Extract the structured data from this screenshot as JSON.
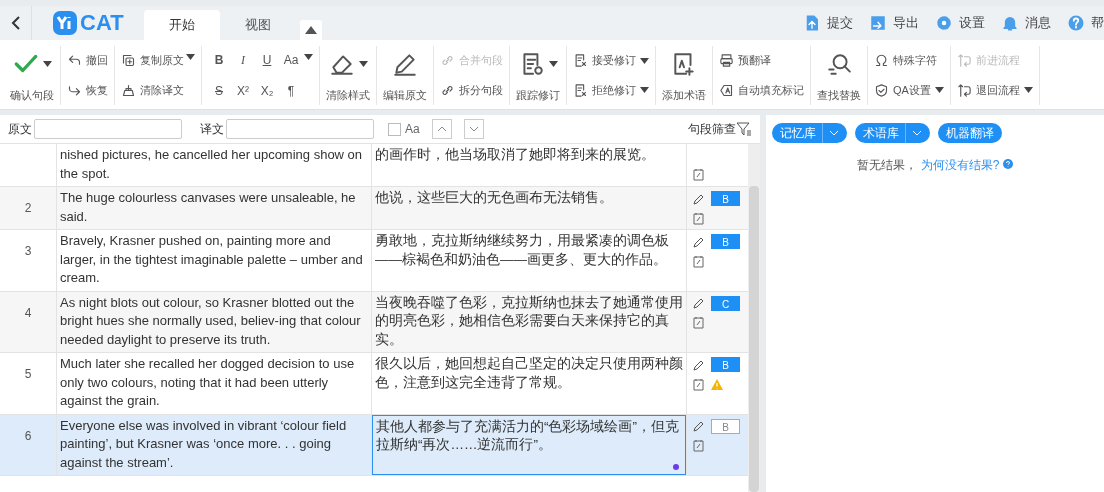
{
  "top_bar": {
    "logo": "CAT",
    "tabs": [
      {
        "label": "开始",
        "selected": true
      },
      {
        "label": "视图",
        "selected": false
      }
    ],
    "actions": [
      {
        "label": "提交"
      },
      {
        "label": "导出"
      },
      {
        "label": "设置"
      },
      {
        "label": "消息"
      },
      {
        "label": "帮"
      }
    ]
  },
  "toolbar": [
    {
      "kind": "big",
      "label": "确认句段",
      "dropdown": true,
      "disabled": false
    },
    {
      "kind": "pair",
      "dropdown": false,
      "items": [
        {
          "label": "撤回",
          "disabled": false,
          "dropdown": false
        },
        {
          "label": "恢复",
          "disabled": false,
          "dropdown": false
        }
      ]
    },
    {
      "kind": "pair",
      "dropdown": true,
      "items": [
        {
          "label": "复制原文",
          "disabled": false,
          "dropdown": false
        },
        {
          "label": "清除译文",
          "disabled": false,
          "dropdown": false
        }
      ]
    },
    {
      "kind": "format",
      "dropdown": true,
      "items": [
        {
          "label": "B",
          "kind": "bold"
        },
        {
          "label": "I",
          "kind": "italic"
        },
        {
          "label": "U",
          "kind": "underline"
        },
        {
          "label": "Aa",
          "kind": "case"
        },
        {
          "label": "S",
          "kind": "strike"
        },
        {
          "label": "X²",
          "kind": "plain"
        },
        {
          "label": "X₂",
          "kind": "plain"
        },
        {
          "label": "¶",
          "kind": "plain"
        }
      ]
    },
    {
      "kind": "big",
      "label": "清除样式",
      "dropdown": true,
      "disabled": false
    },
    {
      "kind": "big",
      "label": "编辑原文",
      "dropdown": false,
      "disabled": false
    },
    {
      "kind": "pair",
      "dropdown": false,
      "items": [
        {
          "label": "合并句段",
          "disabled": true,
          "dropdown": false
        },
        {
          "label": "拆分句段",
          "disabled": false,
          "dropdown": false
        }
      ]
    },
    {
      "kind": "big",
      "label": "跟踪修订",
      "dropdown": true,
      "disabled": false
    },
    {
      "kind": "pair",
      "dropdown": false,
      "items": [
        {
          "label": "接受修订",
          "disabled": false,
          "dropdown": true
        },
        {
          "label": "拒绝修订",
          "disabled": false,
          "dropdown": true
        }
      ]
    },
    {
      "kind": "big",
      "label": "添加术语",
      "dropdown": false,
      "disabled": false
    },
    {
      "kind": "pair",
      "dropdown": false,
      "items": [
        {
          "label": "预翻译",
          "disabled": false,
          "dropdown": false
        },
        {
          "label": "自动填充标记",
          "disabled": false,
          "dropdown": false
        }
      ]
    },
    {
      "kind": "big",
      "label": "查找替换",
      "dropdown": false,
      "disabled": false
    },
    {
      "kind": "pair",
      "dropdown": false,
      "items": [
        {
          "label": "特殊字符",
          "disabled": false,
          "dropdown": false
        },
        {
          "label": "QA设置",
          "disabled": false,
          "dropdown": true
        }
      ]
    },
    {
      "kind": "pair",
      "dropdown": false,
      "items": [
        {
          "label": "前进流程",
          "disabled": true,
          "dropdown": false
        },
        {
          "label": "退回流程",
          "disabled": false,
          "dropdown": true
        }
      ]
    }
  ],
  "search_bar": {
    "source_label": "原文",
    "target_label": "译文",
    "case_label": "Aa",
    "case_checked": false,
    "filter_label": "句段筛查"
  },
  "segments": [
    {
      "source": "nished pictures, he cancelled her upcoming show on the spot.",
      "target": "的画作时，他当场取消了她即将到来的展览。",
      "editable": false,
      "warning": false,
      "selected": false
    },
    {
      "number": "2",
      "source": "The huge colourless canvases were unsaleable, he said.",
      "target": "他说，这些巨大的无色画布无法销售。",
      "editable": true,
      "badge": "B",
      "confirmed": true,
      "warning": false,
      "selected": false
    },
    {
      "number": "3",
      "source": "Bravely, Krasner pushed on, painting more and larger, in the tightest imaginable palette – umber and cream.",
      "target": "勇敢地，克拉斯纳继续努力，用最紧凑的调色板——棕褐色和奶油色——画更多、更大的作品。",
      "editable": true,
      "badge": "B",
      "confirmed": true,
      "warning": false,
      "selected": false
    },
    {
      "number": "4",
      "source": "As night blots out colour, so Krasner blotted out the bright hues she normally used, believ-ing that colour needed daylight to preserve its truth.",
      "target": "当夜晚吞噬了色彩，克拉斯纳也抹去了她通常使用的明亮色彩，她相信色彩需要白天来保持它的真实。",
      "editable": true,
      "badge": "C",
      "confirmed": true,
      "warning": false,
      "selected": false
    },
    {
      "number": "5",
      "source": "Much later she recalled her dogged decision to use only two colours, noting that it had been utterly against the grain.",
      "target": "很久以后，她回想起自己坚定的决定只使用两种颜色，注意到这完全违背了常规。",
      "editable": true,
      "badge": "B",
      "confirmed": true,
      "warning": true,
      "selected": false
    },
    {
      "number": "6",
      "source": "Everyone else was involved in vibrant ‘colour field painting’, but Krasner was ‘once more. . . going against the stream’.",
      "target": "其他人都参与了充满活力的“色彩场域绘画”，但克拉斯纳“再次……逆流而行”。",
      "editable": true,
      "badge": "B",
      "confirmed": false,
      "warning": false,
      "selected": true
    }
  ],
  "side_panel": {
    "tabs": [
      {
        "label": "记忆库",
        "dropdown": true
      },
      {
        "label": "术语库",
        "dropdown": true
      },
      {
        "label": "机器翻译",
        "dropdown": false
      }
    ],
    "message": "暂无结果，",
    "help_link": "为何没有结果?"
  }
}
